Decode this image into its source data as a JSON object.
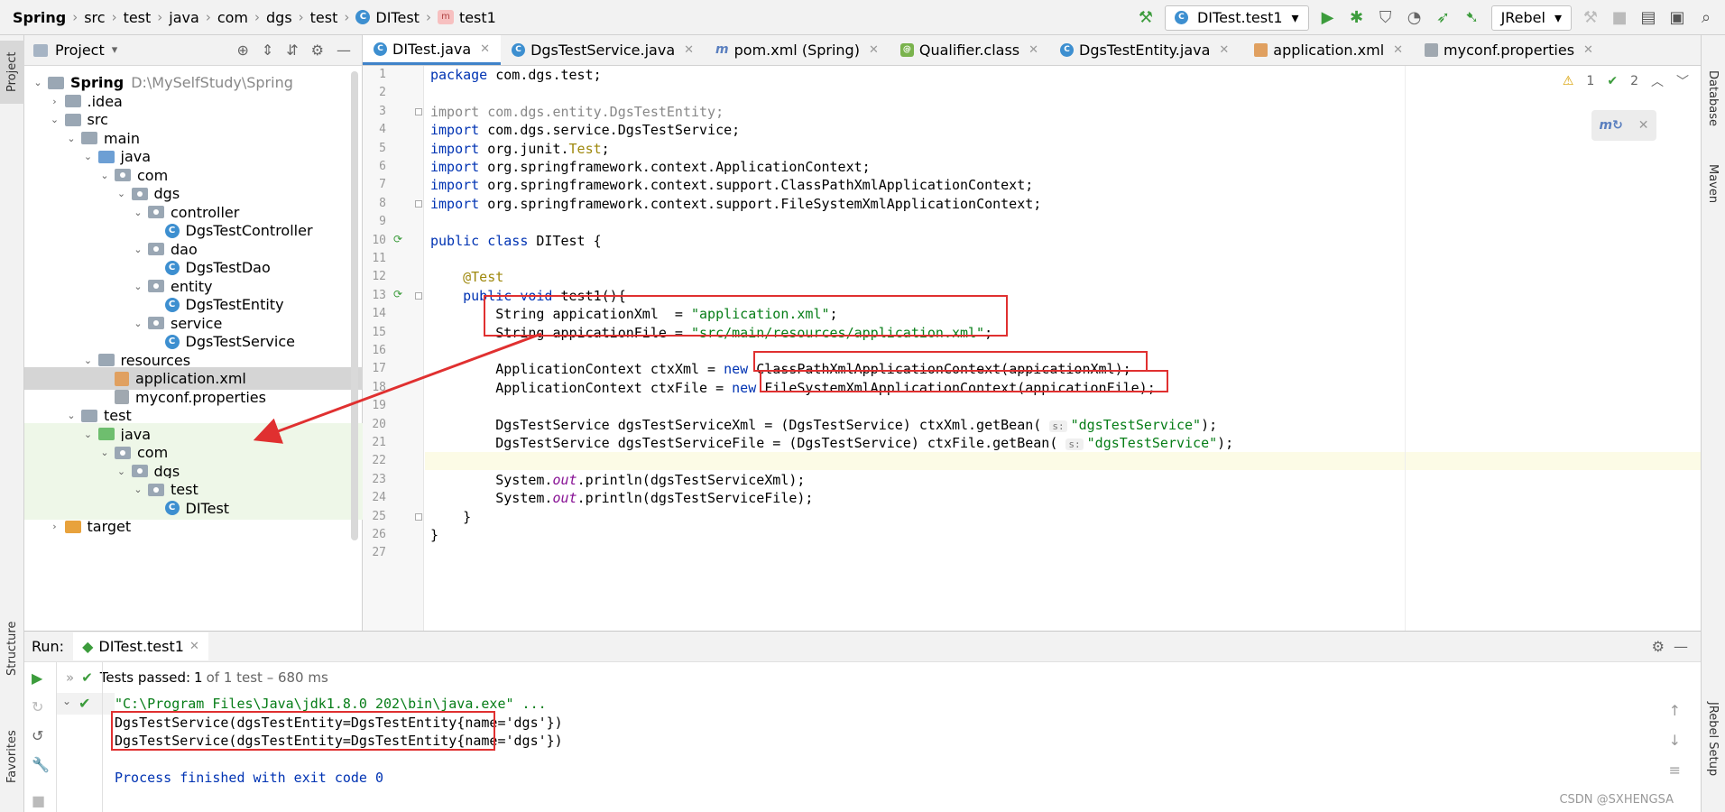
{
  "breadcrumb": [
    "Spring",
    "src",
    "test",
    "java",
    "com",
    "dgs",
    "test",
    "DITest",
    "test1"
  ],
  "toolbar": {
    "run_config": "DITest.test1",
    "jrebel": "JRebel",
    "icons": [
      "hammer-icon",
      "run-icon",
      "debug-icon",
      "coverage-icon",
      "profile-icon",
      "jrebel-run-icon",
      "jrebel-debug-icon",
      "stop-icon",
      "project-structure-icon",
      "layout-icon",
      "search-icon"
    ]
  },
  "left_tabs": [
    "Project",
    "Structure",
    "Favorites"
  ],
  "right_tabs": [
    "Database",
    "Maven",
    "JRebel Setup"
  ],
  "project": {
    "title": "Project",
    "tree": [
      {
        "depth": 0,
        "label": "Spring",
        "extra": "D:\\MySelfStudy\\Spring",
        "icon": "folder",
        "open": true,
        "bold": true
      },
      {
        "depth": 1,
        "label": ".idea",
        "icon": "folder",
        "open": false
      },
      {
        "depth": 1,
        "label": "src",
        "icon": "folder",
        "open": true
      },
      {
        "depth": 2,
        "label": "main",
        "icon": "folder",
        "open": true
      },
      {
        "depth": 3,
        "label": "java",
        "icon": "folder-blue",
        "open": true
      },
      {
        "depth": 4,
        "label": "com",
        "icon": "package",
        "open": true
      },
      {
        "depth": 5,
        "label": "dgs",
        "icon": "package",
        "open": true
      },
      {
        "depth": 6,
        "label": "controller",
        "icon": "package",
        "open": true
      },
      {
        "depth": 7,
        "label": "DgsTestController",
        "icon": "class"
      },
      {
        "depth": 6,
        "label": "dao",
        "icon": "package",
        "open": true
      },
      {
        "depth": 7,
        "label": "DgsTestDao",
        "icon": "class"
      },
      {
        "depth": 6,
        "label": "entity",
        "icon": "package",
        "open": true
      },
      {
        "depth": 7,
        "label": "DgsTestEntity",
        "icon": "class"
      },
      {
        "depth": 6,
        "label": "service",
        "icon": "package",
        "open": true
      },
      {
        "depth": 7,
        "label": "DgsTestService",
        "icon": "class"
      },
      {
        "depth": 3,
        "label": "resources",
        "icon": "folder-res",
        "open": true
      },
      {
        "depth": 4,
        "label": "application.xml",
        "icon": "xml",
        "selected": true
      },
      {
        "depth": 4,
        "label": "myconf.properties",
        "icon": "properties"
      },
      {
        "depth": 2,
        "label": "test",
        "icon": "folder",
        "open": true
      },
      {
        "depth": 3,
        "label": "java",
        "icon": "folder-green",
        "open": true,
        "testbg": true
      },
      {
        "depth": 4,
        "label": "com",
        "icon": "package",
        "open": true,
        "testbg": true
      },
      {
        "depth": 5,
        "label": "dgs",
        "icon": "package",
        "open": true,
        "testbg": true
      },
      {
        "depth": 6,
        "label": "test",
        "icon": "package",
        "open": true,
        "testbg": true
      },
      {
        "depth": 7,
        "label": "DITest",
        "icon": "class",
        "testbg": true
      },
      {
        "depth": 1,
        "label": "target",
        "icon": "folder-orange",
        "open": false
      }
    ]
  },
  "tabs": [
    {
      "label": "DITest.java",
      "icon": "c",
      "active": true
    },
    {
      "label": "DgsTestService.java",
      "icon": "c"
    },
    {
      "label": "pom.xml (Spring)",
      "icon": "m"
    },
    {
      "label": "Qualifier.class",
      "icon": "at"
    },
    {
      "label": "DgsTestEntity.java",
      "icon": "c"
    },
    {
      "label": "application.xml",
      "icon": "x"
    },
    {
      "label": "myconf.properties",
      "icon": "p"
    }
  ],
  "inspections": {
    "warnings": "1",
    "weak": "2"
  },
  "code": [
    [
      [
        "kw",
        "package"
      ],
      [
        "t",
        " com.dgs.test;"
      ]
    ],
    [],
    [
      [
        "imp",
        "import com.dgs.entity.DgsTestEntity;"
      ]
    ],
    [
      [
        "kw",
        "import"
      ],
      [
        "t",
        " com.dgs.service.DgsTestService;"
      ]
    ],
    [
      [
        "kw",
        "import"
      ],
      [
        "t",
        " org.junit."
      ],
      [
        "ann",
        "Test"
      ],
      [
        "t",
        ";"
      ]
    ],
    [
      [
        "kw",
        "import"
      ],
      [
        "t",
        " org.springframework.context.ApplicationContext;"
      ]
    ],
    [
      [
        "kw",
        "import"
      ],
      [
        "t",
        " org.springframework.context.support.ClassPathXmlApplicationContext;"
      ]
    ],
    [
      [
        "kw",
        "import"
      ],
      [
        "t",
        " org.springframework.context.support.FileSystemXmlApplicationContext;"
      ]
    ],
    [],
    [
      [
        "kw",
        "public class"
      ],
      [
        "t",
        " DITest {"
      ]
    ],
    [],
    [
      [
        "t",
        "    "
      ],
      [
        "ann",
        "@Test"
      ]
    ],
    [
      [
        "t",
        "    "
      ],
      [
        "kw",
        "public void"
      ],
      [
        "t",
        " test1(){"
      ]
    ],
    [
      [
        "t",
        "        String appicationXml  = "
      ],
      [
        "str",
        "\"application.xml\""
      ],
      [
        "t",
        ";"
      ]
    ],
    [
      [
        "t",
        "        String appicationFile = "
      ],
      [
        "str",
        "\"src/main/resources/application.xml\""
      ],
      [
        "t",
        ";"
      ]
    ],
    [],
    [
      [
        "t",
        "        ApplicationContext ctxXml = "
      ],
      [
        "kw",
        "new"
      ],
      [
        "t",
        " ClassPathXmlApplicationContext(appicationXml);"
      ]
    ],
    [
      [
        "t",
        "        ApplicationContext ctxFile = "
      ],
      [
        "kw",
        "new"
      ],
      [
        "t",
        " FileSystemXmlApplicationContext(appicationFile);"
      ]
    ],
    [],
    [
      [
        "t",
        "        DgsTestService dgsTestServiceXml = (DgsTestService) ctxXml.getBean( "
      ],
      [
        "hint",
        "s:"
      ],
      [
        "str",
        "\"dgsTestService\""
      ],
      [
        "t",
        ");"
      ]
    ],
    [
      [
        "t",
        "        DgsTestService dgsTestServiceFile = (DgsTestService) ctxFile.getBean( "
      ],
      [
        "hint",
        "s:"
      ],
      [
        "str",
        "\"dgsTestService\""
      ],
      [
        "t",
        ");"
      ]
    ],
    [],
    [
      [
        "t",
        "        System."
      ],
      [
        "it",
        "out"
      ],
      [
        "t",
        ".println(dgsTestServiceXml);"
      ]
    ],
    [
      [
        "t",
        "        System."
      ],
      [
        "it",
        "out"
      ],
      [
        "t",
        ".println(dgsTestServiceFile);"
      ]
    ],
    [
      [
        "t",
        "    }"
      ]
    ],
    [
      [
        "t",
        "}"
      ]
    ],
    []
  ],
  "run": {
    "label": "Run:",
    "tab": "DITest.test1",
    "tests_passed": "Tests passed:",
    "tests_count": "1",
    "tests_rest": "of 1 test – 680 ms",
    "output": [
      {
        "text": "\"C:\\Program Files\\Java\\jdk1.8.0_202\\bin\\java.exe\" ...",
        "color": "#067d17"
      },
      {
        "text": "DgsTestService(dgsTestEntity=DgsTestEntity{name='dgs'})",
        "color": "#000000"
      },
      {
        "text": "DgsTestService(dgsTestEntity=DgsTestEntity{name='dgs'})",
        "color": "#000000"
      },
      {
        "text": "",
        "color": "#000000"
      },
      {
        "text": "Process finished with exit code 0",
        "color": "#0033b3"
      }
    ]
  },
  "watermark": "CSDN @SXHENGSA"
}
